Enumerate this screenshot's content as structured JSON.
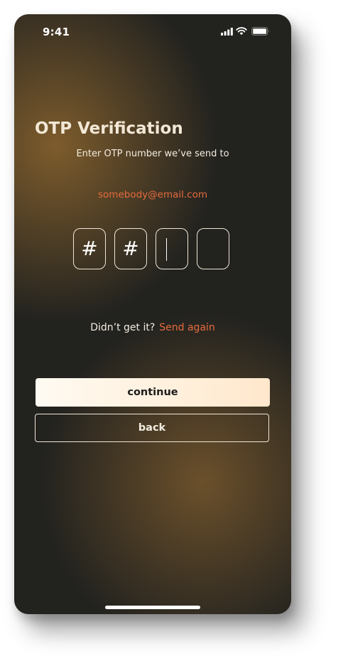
{
  "status_bar": {
    "time": "9:41",
    "icons": [
      "signal-icon",
      "wifi-icon",
      "battery-icon"
    ]
  },
  "screen": {
    "title": "OTP Verification",
    "subtitle": "Enter OTP number we’ve send to",
    "email": "somebody@email.com"
  },
  "otp": {
    "digits": [
      "#",
      "#",
      "",
      ""
    ],
    "active_index": 2
  },
  "resend": {
    "prompt": "Didn’t get it?",
    "link": "Send again"
  },
  "buttons": {
    "continue": "continue",
    "back": "back"
  },
  "colors": {
    "accent": "#e46b3f",
    "background": "#22221f",
    "glow": "#825f2d",
    "button_fill": "#fff0dc"
  }
}
